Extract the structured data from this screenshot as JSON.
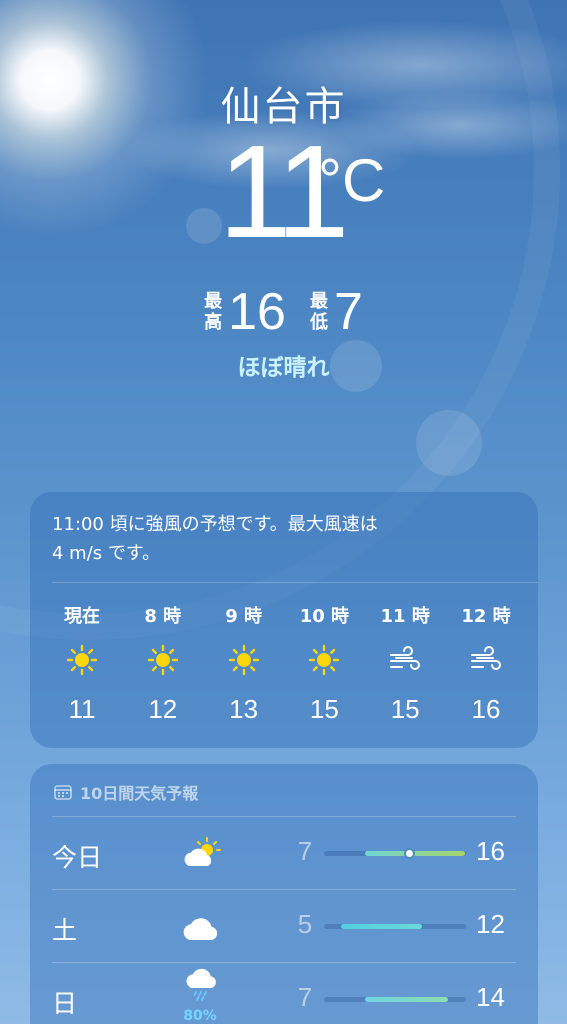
{
  "location": {
    "city": "仙台市"
  },
  "current": {
    "temp": "11",
    "unit": "°C",
    "high_label": [
      "最",
      "高"
    ],
    "high": "16",
    "low_label": [
      "最",
      "低"
    ],
    "low": "7",
    "condition": "ほぼ晴れ"
  },
  "alert": {
    "line1": "11:00 頃に強風の予想です。最大風速は",
    "line2": "4 m/s です。"
  },
  "hourly": [
    {
      "label": "現在",
      "icon": "sun-icon",
      "temp": "11"
    },
    {
      "label": "8 時",
      "icon": "sun-icon",
      "temp": "12"
    },
    {
      "label": "9 時",
      "icon": "sun-icon",
      "temp": "13"
    },
    {
      "label": "10 時",
      "icon": "sun-icon",
      "temp": "15"
    },
    {
      "label": "11 時",
      "icon": "wind-icon",
      "temp": "15"
    },
    {
      "label": "12 時",
      "icon": "wind-icon",
      "temp": "16"
    }
  ],
  "forecast": {
    "title": "10日間天気予報",
    "title_icon": "calendar-icon",
    "days": [
      {
        "day": "今日",
        "icon": "partly-sunny-icon",
        "precip": "",
        "low": "7",
        "high": "16",
        "bar_start": 0.29,
        "bar_end": 0.99,
        "current_marker": 0.6,
        "bar_colors": [
          "#6fd6d4",
          "#a6d46a"
        ]
      },
      {
        "day": "土",
        "icon": "cloud-icon",
        "precip": "",
        "low": "5",
        "high": "12",
        "bar_start": 0.12,
        "bar_end": 0.69,
        "bar_colors": [
          "#52cfe0",
          "#6bd8d8"
        ]
      },
      {
        "day": "日",
        "icon": "rain-icon",
        "precip": "80%",
        "low": "7",
        "high": "14",
        "bar_start": 0.29,
        "bar_end": 0.87,
        "bar_colors": [
          "#6cd6e0",
          "#8edcb0"
        ]
      }
    ]
  },
  "colors": {
    "sky_top": "#3f74b3",
    "sky_bottom": "#8fbbe6",
    "condition_text": "#c9f3ff",
    "sun_icon": "#ffd60a",
    "precip_text": "#76d6ff"
  }
}
